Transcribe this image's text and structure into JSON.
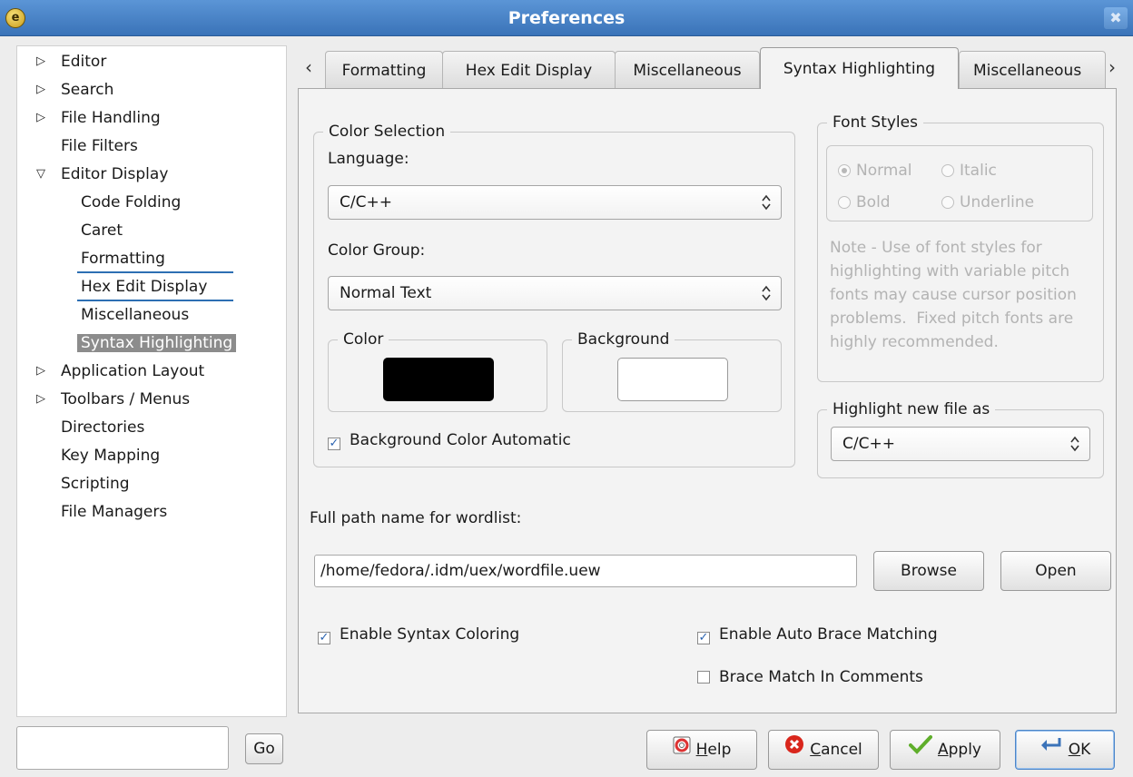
{
  "window": {
    "title": "Preferences",
    "close_glyph": "✖",
    "icon": "app-logo-icon"
  },
  "tree": {
    "items": [
      {
        "label": "Editor",
        "level": 0,
        "arrow": "▷"
      },
      {
        "label": "Search",
        "level": 0,
        "arrow": "▷"
      },
      {
        "label": "File Handling",
        "level": 0,
        "arrow": "▷"
      },
      {
        "label": "File Filters",
        "level": 0,
        "arrow": ""
      },
      {
        "label": "Editor Display",
        "level": 0,
        "arrow": "▽"
      },
      {
        "label": "Code Folding",
        "level": 1,
        "arrow": ""
      },
      {
        "label": "Caret",
        "level": 1,
        "arrow": ""
      },
      {
        "label": "Formatting",
        "level": 1,
        "arrow": ""
      },
      {
        "label": "Hex Edit Display",
        "level": 1,
        "arrow": ""
      },
      {
        "label": "Miscellaneous",
        "level": 1,
        "arrow": ""
      },
      {
        "label": "Syntax Highlighting",
        "level": 1,
        "arrow": ""
      },
      {
        "label": "Application Layout",
        "level": 0,
        "arrow": "▷"
      },
      {
        "label": "Toolbars / Menus",
        "level": 0,
        "arrow": "▷"
      },
      {
        "label": "Directories",
        "level": 0,
        "arrow": ""
      },
      {
        "label": "Key Mapping",
        "level": 0,
        "arrow": ""
      },
      {
        "label": "Scripting",
        "level": 0,
        "arrow": ""
      },
      {
        "label": "File Managers",
        "level": 0,
        "arrow": ""
      }
    ],
    "selected": "Syntax Highlighting"
  },
  "search": {
    "value": "",
    "go_label": "Go"
  },
  "tabs": {
    "scroll_left": "‹",
    "scroll_right": "›",
    "items": [
      "Formatting",
      "Hex Edit Display",
      "Miscellaneous",
      "Syntax Highlighting",
      "Miscellaneous"
    ],
    "active": "Syntax Highlighting"
  },
  "color_selection": {
    "title": "Color Selection",
    "language_label": "Language:",
    "language_value": "C/C++",
    "group_label": "Color Group:",
    "group_value": "Normal Text",
    "color_label": "Color",
    "color_value": "#000000",
    "background_label": "Background",
    "background_value": "#ffffff",
    "bg_auto_label": "Background Color Automatic",
    "bg_auto_checked": true
  },
  "font_styles": {
    "title": "Font Styles",
    "normal": "Normal",
    "italic": "Italic",
    "bold": "Bold",
    "underline": "Underline",
    "selected": "Normal",
    "note": "Note - Use of font styles for highlighting with variable pitch fonts may cause cursor position problems.  Fixed pitch fonts are highly recommended."
  },
  "highlight_new": {
    "title": "Highlight new file as",
    "value": "C/C++"
  },
  "wordlist": {
    "label": "Full path name for wordlist:",
    "value": "/home/fedora/.idm/uex/wordfile.uew",
    "browse_label": "Browse",
    "open_label": "Open"
  },
  "options": {
    "syntax_coloring": {
      "label": "Enable Syntax Coloring",
      "checked": true
    },
    "auto_brace": {
      "label": "Enable Auto Brace Matching",
      "checked": true
    },
    "brace_comments": {
      "label": "Brace Match In Comments",
      "checked": false
    }
  },
  "buttons": {
    "help": "Help",
    "cancel": "Cancel",
    "apply": "Apply",
    "ok": "OK"
  },
  "colors": {
    "titlebar": "#3a73b8",
    "accent": "#2d6fb3",
    "selection": "#8c8c8c"
  }
}
